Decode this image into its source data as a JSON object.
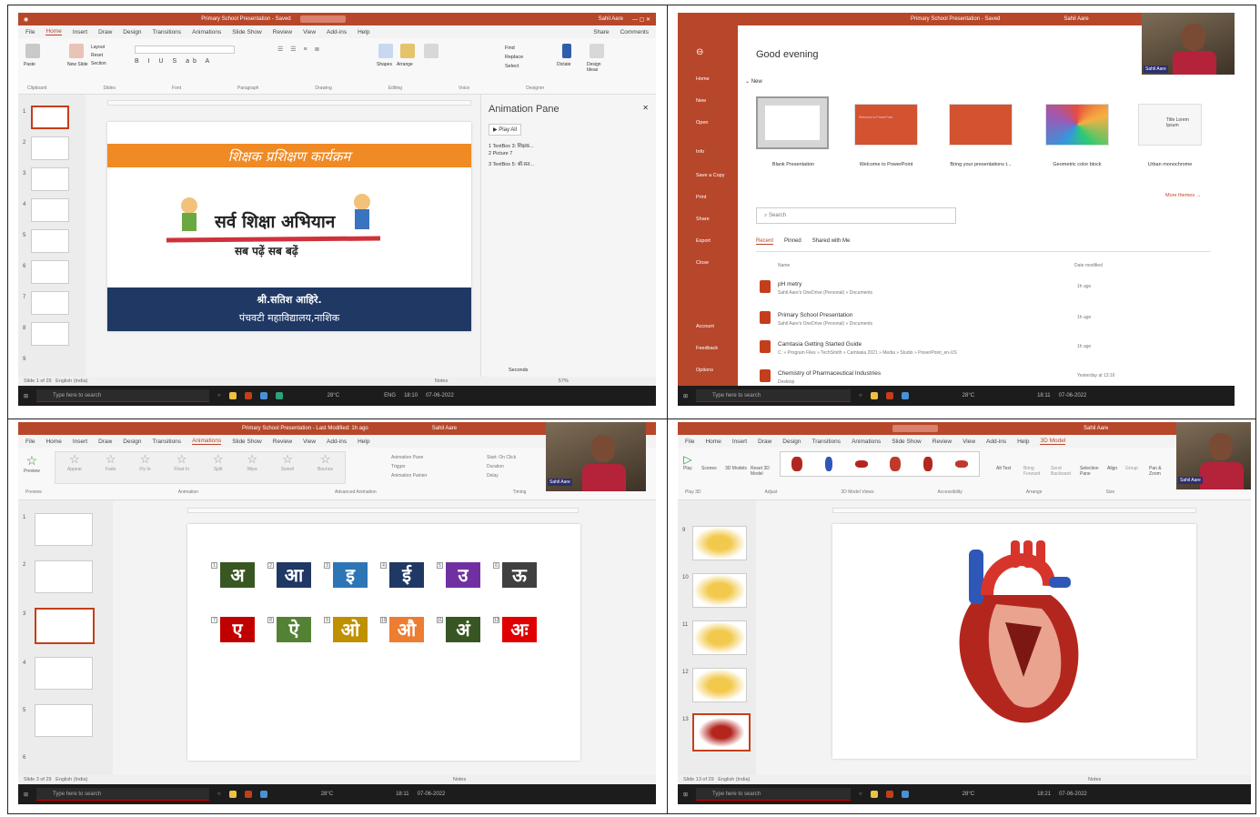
{
  "panel1": {
    "window_title": "Primary School Presentation - Saved",
    "search_placeholder": "Search",
    "user": "Sahil Aare",
    "tabs": [
      "File",
      "Home",
      "Insert",
      "Draw",
      "Design",
      "Transitions",
      "Animations",
      "Slide Show",
      "Review",
      "View",
      "Add-ins",
      "Help"
    ],
    "active_tab": "Home",
    "ribbon_groups": [
      "Clipboard",
      "Slides",
      "Font",
      "Paragraph",
      "Drawing",
      "Editing",
      "Voice",
      "Designer"
    ],
    "ribbon_buttons": {
      "paste": "Paste",
      "new_slide": "New Slide",
      "layout": "Layout",
      "reset": "Reset",
      "section": "Section",
      "shapes": "Shapes",
      "arrange": "Arrange",
      "quick_styles": "Quick Styles",
      "find": "Find",
      "replace": "Replace",
      "select": "Select",
      "dictate": "Dictate",
      "design_ideas": "Design Ideas",
      "share": "Share",
      "comments": "Comments"
    },
    "thumb_numbers": [
      "1",
      "2",
      "3",
      "4",
      "5",
      "6",
      "7",
      "8",
      "9"
    ],
    "slide": {
      "banner_text": "शिक्षक प्रशिक्षण कार्यक्रम",
      "logo_main": "सर्व शिक्षा अभियान",
      "logo_sub": "सब पढ़ें सब बढ़ें",
      "name": "श्री.सतिश आहिरे.",
      "college": "पंचवटी महाविद्यालय,नाशिक",
      "banner_color": "#f08a24",
      "footer_color": "#1f3864"
    },
    "animation_pane": {
      "title": "Animation Pane",
      "play_all": "Play All",
      "items": [
        "1 TextBox 3: शिक्षक...",
        "2 Picture 7",
        "3 TextBox 5: श्री.सत..."
      ],
      "seconds": "Seconds"
    },
    "status": {
      "left": "Slide 1 of 29",
      "lang": "English (India)",
      "notes": "Notes",
      "zoom": "57%"
    },
    "taskbar": {
      "search": "Type here to search",
      "temp": "28°C",
      "lang": "ENG",
      "time": "18:10",
      "date": "07-06-2022"
    }
  },
  "panel2": {
    "window_title": "Primary School Presentation - Saved",
    "user": "Sahil Aare",
    "greeting": "Good evening",
    "nav": [
      "Home",
      "New",
      "Open",
      "Info",
      "Save a Copy",
      "Print",
      "Share",
      "Export",
      "Close",
      "Account",
      "Feedback",
      "Options"
    ],
    "new_label": "New",
    "templates": [
      "Blank Presentation",
      "Welcome to PowerPoint",
      "Bring your presentations t...",
      "Geometric color block",
      "Urban monochrome"
    ],
    "welcome_title": "Welcome to PowerPoint",
    "urban_title": "Title Lorem Ipsum",
    "more_themes": "More themes →",
    "search_placeholder": "Search",
    "file_tabs": [
      "Recent",
      "Pinned",
      "Shared with Me"
    ],
    "col_name": "Name",
    "col_date": "Date modified",
    "files": [
      {
        "name": "pH metry",
        "path": "Sahil Aare's OneDrive (Personal) » Documents",
        "date": "1h ago"
      },
      {
        "name": "Primary School Presentation",
        "path": "Sahil Aare's OneDrive (Personal) » Documents",
        "date": "1h ago"
      },
      {
        "name": "Camtasia Getting Started Guide",
        "path": "C: » Program Files » TechSmith » Camtasia 2021 » Media » Studio » PowerPoint_en-US",
        "date": "1h ago"
      },
      {
        "name": "Chemistry of Pharmaceutical Industries",
        "path": "Desktop",
        "date": "Yesterday at 13:16"
      }
    ],
    "taskbar": {
      "search": "Type here to search",
      "temp": "28°C",
      "time": "18:11",
      "date": "07-06-2022"
    }
  },
  "panel3": {
    "window_title": "Primary School Presentation - Last Modified: 1h ago",
    "user": "Sahil Aare",
    "tabs": [
      "File",
      "Home",
      "Insert",
      "Draw",
      "Design",
      "Transitions",
      "Animations",
      "Slide Show",
      "Review",
      "View",
      "Add-ins",
      "Help"
    ],
    "active_tab": "Animations",
    "effects": [
      "Preview",
      "None",
      "Appear",
      "Fade",
      "Fly In",
      "Float In",
      "Split",
      "Wipe",
      "Shape",
      "Wheel",
      "Random Bars",
      "Grow & Turn",
      "Zoom",
      "Swivel",
      "Bounce",
      "Effect Options"
    ],
    "advanced": {
      "add": "Add Animation",
      "pane": "Animation Pane",
      "trigger": "Trigger",
      "painter": "Animation Painter",
      "start": "Start: On Click",
      "duration": "Duration",
      "delay": "Delay",
      "move_earlier": "Move Earlier",
      "move_later": "Move Later"
    },
    "groups": [
      "Preview",
      "Animation",
      "Advanced Animation",
      "Timing"
    ],
    "thumb_numbers": [
      "1",
      "2",
      "3",
      "4",
      "5",
      "6"
    ],
    "vowels_row1": [
      "अ",
      "आ",
      "इ",
      "ई",
      "उ",
      "ऊ"
    ],
    "vowels_row2": [
      "ए",
      "ऐ",
      "ओ",
      "औ",
      "अं",
      "अः"
    ],
    "colors_row1": [
      "#385723",
      "#1f3864",
      "#2e75b6",
      "#203864",
      "#7030a0",
      "#404040"
    ],
    "colors_row2": [
      "#c00000",
      "#548235",
      "#bf9000",
      "#ed7d31",
      "#375623",
      "#e00000"
    ],
    "status": {
      "left": "Slide 3 of 29",
      "lang": "English (India)",
      "notes": "Notes"
    },
    "taskbar": {
      "search": "Type here to search",
      "temp": "28°C",
      "time": "18:11",
      "date": "07-06-2022"
    }
  },
  "panel4": {
    "window_title": "Sahil Aare",
    "search_placeholder": "Search",
    "user": "Sahil Aare",
    "tabs": [
      "File",
      "Home",
      "Insert",
      "Draw",
      "Design",
      "Transitions",
      "Animations",
      "Slide Show",
      "Review",
      "View",
      "Add-ins",
      "Help",
      "3D Model"
    ],
    "active_tab": "3D Model",
    "ribbon": {
      "play": "Play",
      "scenes": "Scenes",
      "models3d": "3D Models",
      "reset": "Reset 3D Model",
      "alt_text": "Alt Text",
      "bring_forward": "Bring Forward",
      "send_backward": "Send Backward",
      "selection_pane": "Selection Pane",
      "align": "Align",
      "group": "Group",
      "pan_zoom": "Pan & Zoom"
    },
    "groups": [
      "Play 3D",
      "Adjust",
      "3D Model Views",
      "Accessibility",
      "Arrange",
      "Size"
    ],
    "thumb_numbers": [
      "9",
      "10",
      "11",
      "12",
      "13"
    ],
    "status": {
      "left": "Slide 13 of 29",
      "lang": "English (India)",
      "notes": "Notes"
    },
    "taskbar": {
      "search": "Type here to search",
      "temp": "28°C",
      "time": "18:21",
      "date": "07-06-2022"
    }
  }
}
